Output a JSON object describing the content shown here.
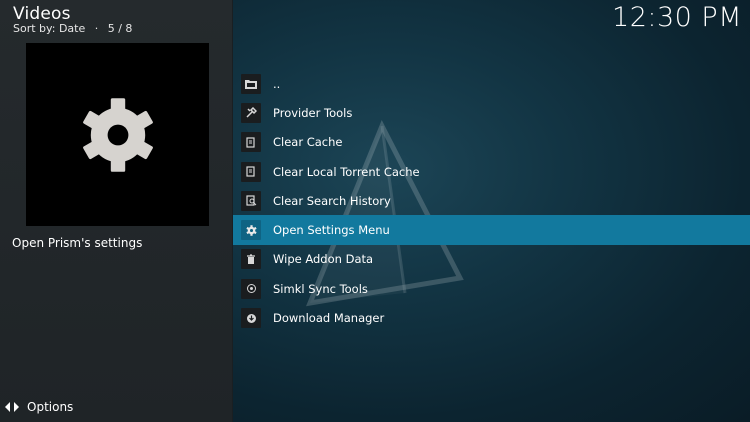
{
  "header": {
    "title": "Videos",
    "sort_label": "Sort by: Date",
    "separator": "·",
    "position": "5 / 8"
  },
  "clock": "12:30 PM",
  "preview": {
    "icon": "gear-icon",
    "description": "Open Prism's settings"
  },
  "footer": {
    "options_label": "Options",
    "icon": "options-arrows-icon"
  },
  "list": {
    "items": [
      {
        "label": "..",
        "icon": "folder-back-icon"
      },
      {
        "label": "Provider Tools",
        "icon": "tools-icon"
      },
      {
        "label": "Clear Cache",
        "icon": "clear-cache-icon"
      },
      {
        "label": "Clear Local Torrent Cache",
        "icon": "clear-torrent-cache-icon"
      },
      {
        "label": "Clear Search History",
        "icon": "clear-search-icon"
      },
      {
        "label": "Open Settings Menu",
        "icon": "settings-icon",
        "selected": true
      },
      {
        "label": "Wipe Addon Data",
        "icon": "trash-icon"
      },
      {
        "label": "Simkl Sync Tools",
        "icon": "sync-icon"
      },
      {
        "label": "Download Manager",
        "icon": "download-icon"
      }
    ]
  },
  "colors": {
    "selection": "#12799e",
    "left_panel": "#252a2d",
    "background": "#123443"
  }
}
